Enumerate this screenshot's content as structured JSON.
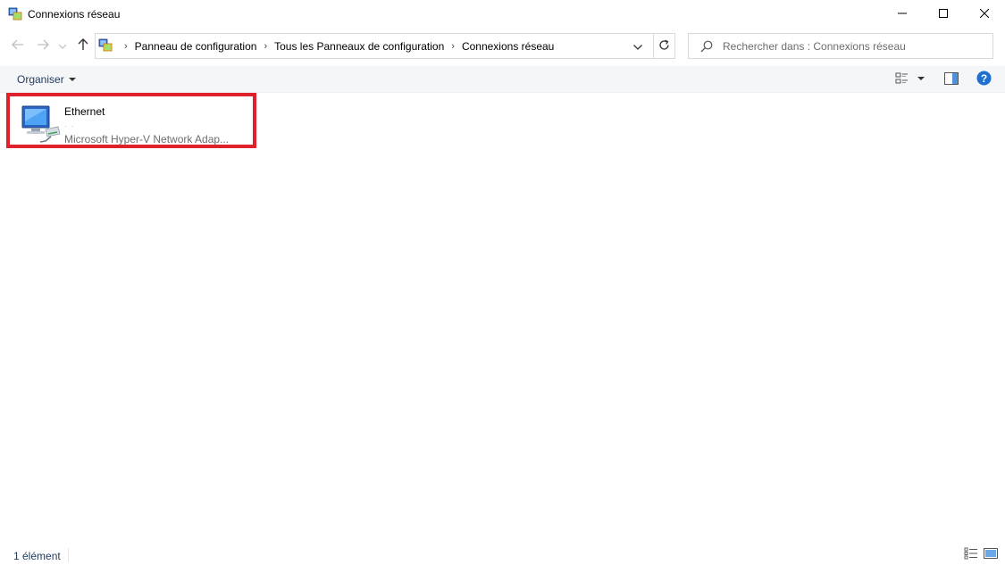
{
  "window": {
    "title": "Connexions réseau",
    "app_icon": "network-connections-icon",
    "controls": [
      "minimize-icon",
      "maximize-icon",
      "close-icon"
    ]
  },
  "nav": {
    "back_icon": "arrow-left-icon",
    "forward_icon": "arrow-right-icon",
    "recent_icon": "chevron-down-icon",
    "up_icon": "arrow-up-icon"
  },
  "address": {
    "breadcrumbs": [
      "Panneau de configuration",
      "Tous les Panneaux de configuration",
      "Connexions réseau"
    ],
    "separator": "›"
  },
  "search": {
    "placeholder": "Rechercher dans : Connexions réseau"
  },
  "toolbar": {
    "organise_label": "Organiser"
  },
  "connections": [
    {
      "name": "Ethernet",
      "status": "· ·",
      "device": "Microsoft Hyper-V Network Adap...",
      "icon": "ethernet-adapter-icon"
    }
  ],
  "statusbar": {
    "count": "1 élément"
  },
  "colors": {
    "highlight_border": "#e0202b",
    "toolbar_bg": "#f5f6f7",
    "help_blue": "#1e6fd0",
    "link_text": "#1e395b"
  }
}
